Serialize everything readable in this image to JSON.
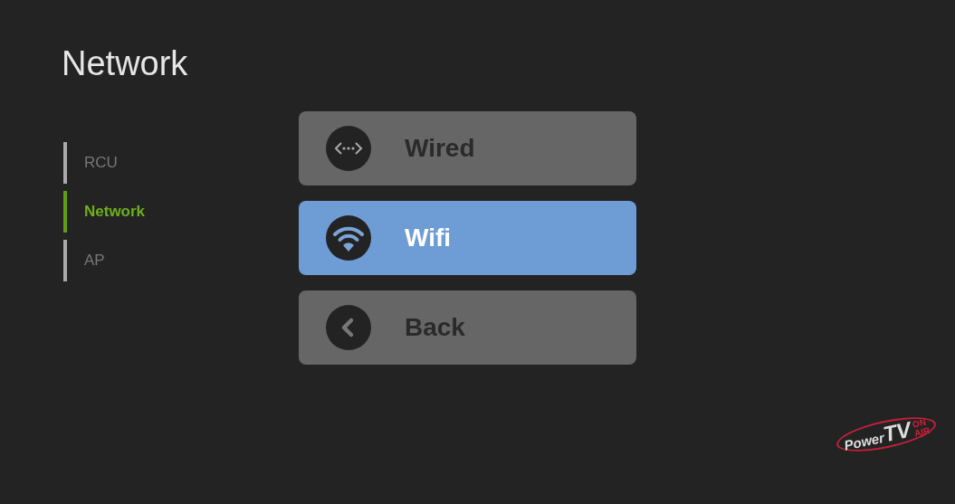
{
  "title": "Network",
  "sidebar": {
    "items": [
      {
        "label": "RCU",
        "selected": false
      },
      {
        "label": "Network",
        "selected": true
      },
      {
        "label": "AP",
        "selected": false
      }
    ]
  },
  "options": [
    {
      "label": "Wired",
      "kind": "wired",
      "selected": false
    },
    {
      "label": "Wifi",
      "kind": "wifi",
      "selected": true
    },
    {
      "label": "Back",
      "kind": "back",
      "selected": false
    }
  ],
  "logo": {
    "word": "Power",
    "mark": "TV",
    "tag_top": "ON",
    "tag_bottom": "AIR"
  }
}
